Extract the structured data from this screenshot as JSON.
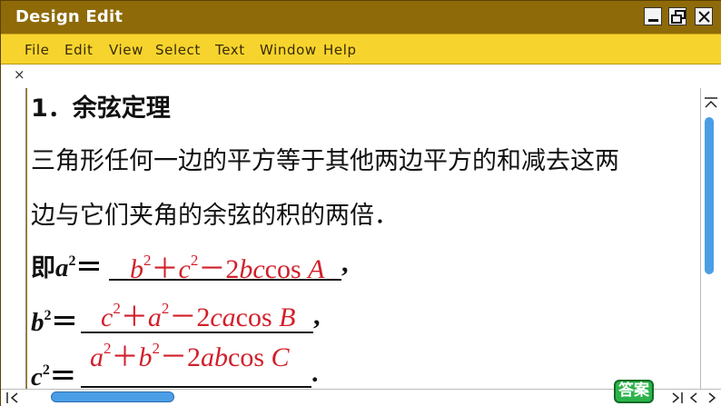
{
  "window": {
    "title": "Design Edit",
    "controls": {
      "minimize_icon": "minimize-icon",
      "maximize_icon": "restore-icon",
      "close_icon": "close-icon"
    }
  },
  "menubar": {
    "items": [
      "File",
      "Edit",
      "View",
      "Select",
      "Text",
      "Window",
      "Help"
    ]
  },
  "document": {
    "heading": "1．余弦定理",
    "paragraph_line1": "三角形任何一边的平方等于其他两边平方的和减去这两",
    "paragraph_line2": "边与它们夹角的余弦的积的两倍．",
    "formula1": {
      "prefix": "即",
      "var": "a",
      "exp": "2",
      "equals": "＝",
      "answer": {
        "t1": "b",
        "e1": "2",
        "op1": "＋",
        "t2": "c",
        "e2": "2",
        "op2": "－",
        "t3": "2",
        "t4": "bc",
        "fn": "cos ",
        "ang": "A"
      },
      "trail": ","
    },
    "formula2": {
      "var": "b",
      "exp": "2",
      "equals": "＝",
      "answer": {
        "t1": "c",
        "e1": "2",
        "op1": "＋",
        "t2": "a",
        "e2": "2",
        "op2": "－",
        "t3": "2",
        "t4": "ca",
        "fn": "cos ",
        "ang": "B"
      },
      "trail": ","
    },
    "formula3": {
      "var": "c",
      "exp": "2",
      "equals": "＝",
      "answer": {
        "t1": "a",
        "e1": "2",
        "op1": "＋",
        "t2": "b",
        "e2": "2",
        "op2": "－",
        "t3": "2",
        "t4": "ab",
        "fn": "cos ",
        "ang": "C"
      },
      "trail": "."
    }
  },
  "answer_button": {
    "label": "答案"
  },
  "tab_close": "×",
  "colors": {
    "titlebar": "#8e6a08",
    "menubar": "#f6d42d",
    "answer_text": "#d21f2a",
    "scrollbar_thumb": "#4a9ee6",
    "answer_button": "#2bb34a"
  }
}
